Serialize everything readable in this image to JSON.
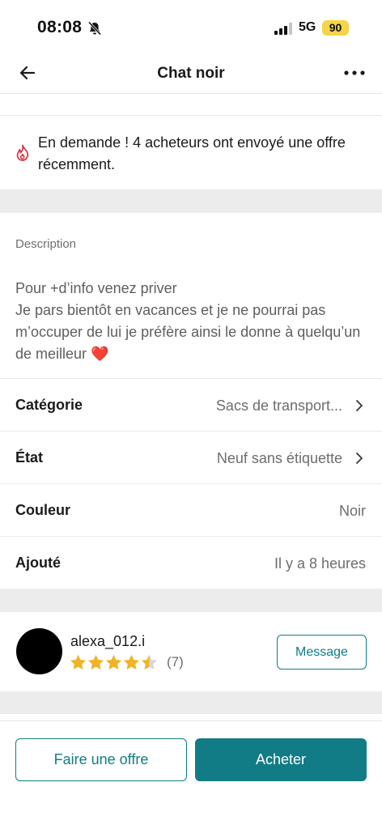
{
  "status_bar": {
    "time": "08:08",
    "network": "5G",
    "battery": "90"
  },
  "header": {
    "title": "Chat noir"
  },
  "demand": {
    "text": "En demande ! 4 acheteurs ont envoyé une offre récemment."
  },
  "description": {
    "label": "Description",
    "line1": "Pour +d’info venez priver",
    "line2": "Je pars bientôt en vacances et je ne pourrai pas m’occuper de lui je préfère ainsi le donne à quelqu’un de meilleur",
    "emoji": "❤️"
  },
  "attributes": [
    {
      "label": "Catégorie",
      "value": "Sacs de transport..."
    },
    {
      "label": "État",
      "value": "Neuf sans étiquette"
    },
    {
      "label": "Couleur",
      "value": "Noir"
    },
    {
      "label": "Ajouté",
      "value": "Il y a 8 heures"
    }
  ],
  "seller": {
    "username": "alexa_012.i",
    "rating": 4.5,
    "rating_max": 5,
    "review_count": "(7)",
    "message_label": "Message"
  },
  "actions": {
    "offer_label": "Faire une offre",
    "buy_label": "Acheter"
  },
  "colors": {
    "accent": "#117c85",
    "star": "#f0b429",
    "flame": "#d6323f"
  }
}
